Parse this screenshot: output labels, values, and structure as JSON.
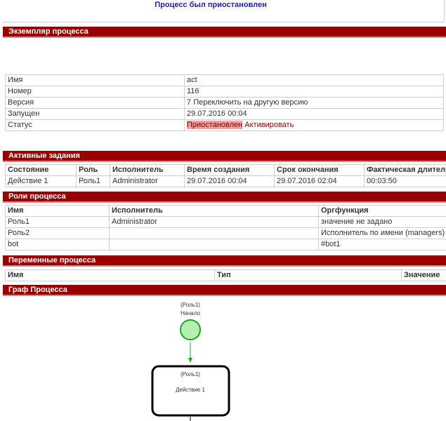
{
  "notice": "Процесс был приостановлен",
  "sections": {
    "instance": "Экземпляр процесса",
    "tasks": "Активные задания",
    "roles": "Роли процесса",
    "variables": "Переменные процесса",
    "graph": "Граф Процесса"
  },
  "instance": {
    "name_label": "Имя",
    "name_value": "act",
    "number_label": "Номер",
    "number_value": "116",
    "version_label": "Версия",
    "version_value": "7",
    "switch_version_link": "Переключить на другую версию",
    "started_label": "Запущен",
    "started_value": "29.07.2016 00:04",
    "status_label": "Статус",
    "status_value": "Приостановлен",
    "activate_link": "Активировать"
  },
  "tasks": {
    "headers": [
      "Состояние",
      "Роль",
      "Исполнитель",
      "Время создания",
      "Срок окончания",
      "Фактическая длительность"
    ],
    "rows": [
      [
        "Действие 1",
        "Роль1",
        "Administrator",
        "29.07.2016 00:04",
        "29.07.2016 02:04",
        "00:03:50"
      ]
    ]
  },
  "roles": {
    "headers": [
      "Имя",
      "Исполнитель",
      "Оргфункция"
    ],
    "rows": [
      [
        "Роль1",
        "Administrator",
        "значение не задано"
      ],
      [
        "Роль2",
        "",
        "Исполнитель по имени (managers)"
      ],
      [
        "bot",
        "",
        "#bot1"
      ]
    ]
  },
  "variables": {
    "headers": [
      "Имя",
      "Тип",
      "Значение"
    ]
  },
  "graph": {
    "start_role": "(Роль1)",
    "start_name": "Начало",
    "task_role": "(Роль1)",
    "task_name": "Действие 1",
    "colors": {
      "start_fill": "#b6f0b0",
      "start_stroke": "#1ea51e",
      "arrow": "#1ea51e",
      "task_stroke": "#000000"
    }
  },
  "colors": {
    "section_bg": "#9a0000",
    "notice": "#1b1bd0",
    "status_badge": "#f0a0a0"
  }
}
